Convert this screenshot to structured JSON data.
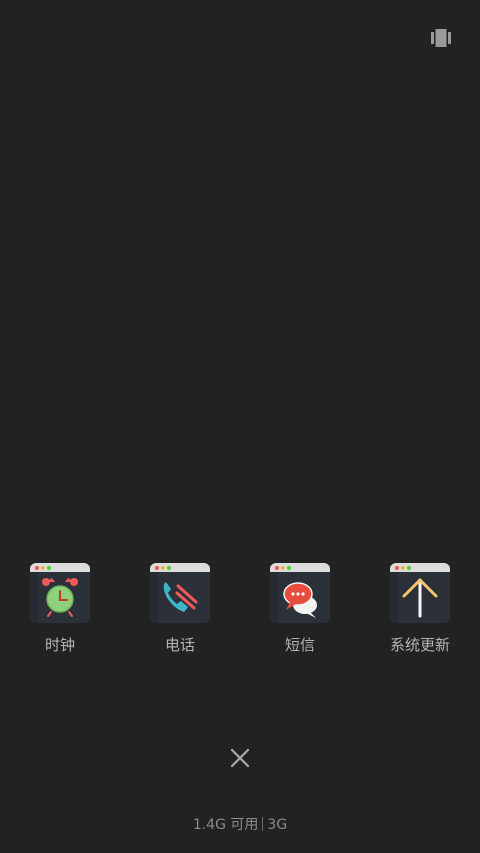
{
  "top_bar": {
    "layout_toggle_icon": "stacked-cards-icon"
  },
  "recent_apps": [
    {
      "label": "时钟",
      "icon": "alarm-clock-icon",
      "accent": "#8fd17a"
    },
    {
      "label": "电话",
      "icon": "phone-handset-icon",
      "accent": "#f25a5a"
    },
    {
      "label": "短信",
      "icon": "chat-bubbles-icon",
      "accent": "#e94b3c"
    },
    {
      "label": "系统更新",
      "icon": "arrow-up-icon",
      "accent": "#f5c46a"
    }
  ],
  "window_dots": [
    "#ef5350",
    "#f5b83d",
    "#4cd137"
  ],
  "bottom": {
    "close_icon": "close-icon",
    "memory_available": "1.4G 可用",
    "memory_total": "3G"
  }
}
